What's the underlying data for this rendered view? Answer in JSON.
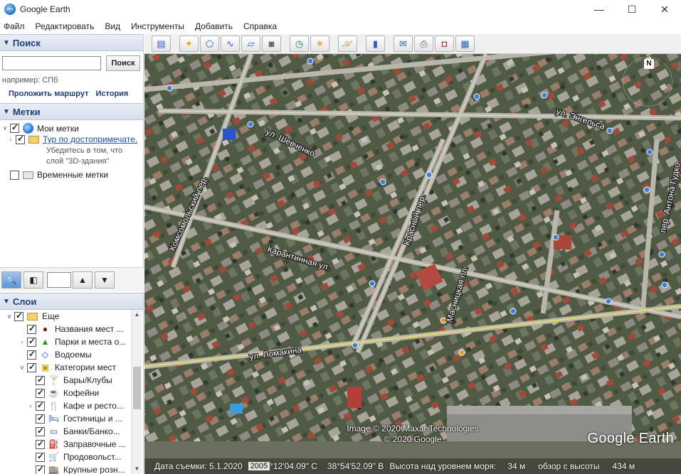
{
  "window": {
    "title": "Google Earth",
    "controls": {
      "minimize": "—",
      "maximize": "☐",
      "close": "✕"
    }
  },
  "menu": [
    "Файл",
    "Редактировать",
    "Вид",
    "Инструменты",
    "Добавить",
    "Справка"
  ],
  "search": {
    "header": "Поиск",
    "input_value": "",
    "button_label": "Поиск",
    "hint": "например: СПб",
    "route_link": "Проложить маршрут",
    "history_link": "История"
  },
  "places": {
    "header": "Метки",
    "my_places": "Мои метки",
    "tour_link": "Тур по достопримечате.",
    "tour_note_1": "Убедитесь в том, что",
    "tour_note_2": "слой \"3D-здания\"",
    "temporary": "Временные метки"
  },
  "layers": {
    "header": "Слои",
    "items": [
      {
        "label": "Еще",
        "icon": "folder-icon"
      },
      {
        "label": "Названия мест ...",
        "icon": "dot-icon"
      },
      {
        "label": "Парки и места о...",
        "icon": "tree-icon"
      },
      {
        "label": "Водоемы",
        "icon": "water-icon"
      },
      {
        "label": "Категории мест",
        "icon": "category-icon"
      },
      {
        "label": "Бары/Клубы",
        "icon": "cocktail-icon"
      },
      {
        "label": "Кофейни",
        "icon": "coffee-icon"
      },
      {
        "label": "Кафе и ресто...",
        "icon": "restaurant-icon"
      },
      {
        "label": "Гостиницы и ...",
        "icon": "bed-icon"
      },
      {
        "label": "Банки/Банко...",
        "icon": "bank-icon"
      },
      {
        "label": "Заправочные ...",
        "icon": "fuel-icon"
      },
      {
        "label": "Продовольст...",
        "icon": "cart-icon"
      },
      {
        "label": "Крупные розн...",
        "icon": "shop-icon"
      }
    ]
  },
  "map": {
    "streets": {
      "engelsa": "ул. Энгельса",
      "shevchenko": "ул. Шевченко",
      "komsomolsky": "Комсомольский пер.",
      "krasny": "Красный пер.",
      "karantinnaya": "Карантинная ул.",
      "masnitskaya": "Масницкая пл.",
      "lomakina": "ул. Ломакина",
      "antona_gudko": "пер. Антона Гудко"
    },
    "attribution_1": "Image © 2020 Maxar Technologies",
    "attribution_2": "© 2020 Google",
    "watermark": "Google Earth",
    "compass_n": "N",
    "status": {
      "date": "Дата съемки: 5.1.2020",
      "year": "2005",
      "lat": "°12'04.09\" С",
      "lon": "38°54'52.09\" В",
      "altitude": "Высота над уровнем моря:",
      "altitude_value": "34 м",
      "eye": "обзор с высоты",
      "eye_value": "434 м"
    }
  }
}
